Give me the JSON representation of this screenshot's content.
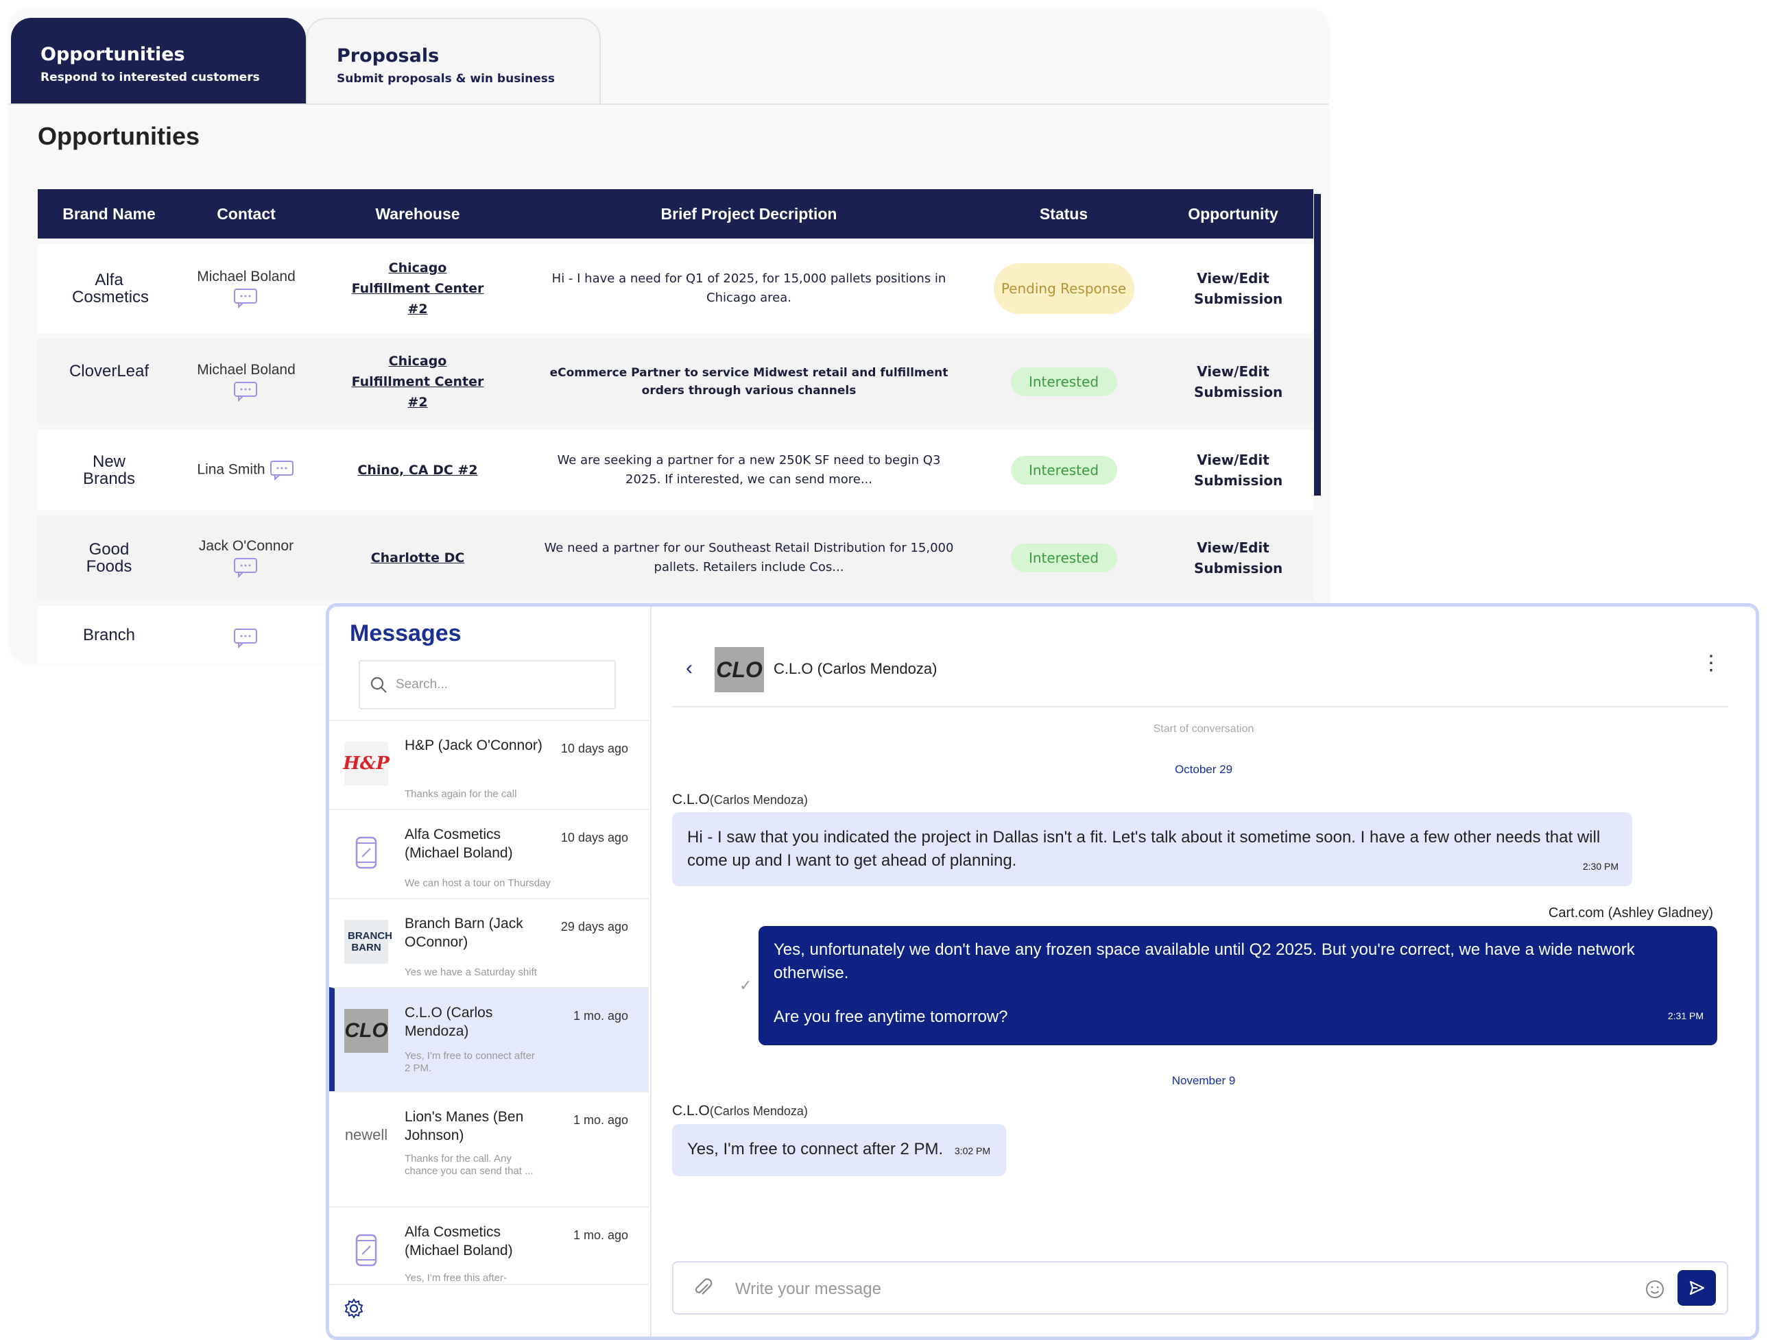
{
  "tabs": [
    {
      "title": "Opportunities",
      "subtitle": "Respond to interested customers"
    },
    {
      "title": "Proposals",
      "subtitle": "Submit proposals & win business"
    }
  ],
  "page_title": "Opportunities",
  "table": {
    "headers": [
      "Brand Name",
      "Contact",
      "Warehouse",
      "Brief Project Decription",
      "Status",
      "Opportunity"
    ],
    "rows": [
      {
        "brand": "Alfa Cosmetics",
        "contact": "Michael Boland",
        "warehouse": "Chicago Fulfillment Center #2",
        "description": "Hi - I have a need for Q1 of 2025, for 15,000 pallets positions in Chicago area.",
        "status": "Pending Response",
        "action": "View/Edit Submission"
      },
      {
        "brand": "CloverLeaf",
        "contact": "Michael Boland",
        "warehouse": "Chicago Fulfillment Center #2",
        "description": "eCommerce Partner to service Midwest retail and fulfillment orders through various channels",
        "status": "Interested",
        "action": "View/Edit Submission"
      },
      {
        "brand": "New Brands",
        "contact": "Lina Smith",
        "warehouse": "Chino, CA DC #2",
        "description": "We are seeking a partner for a new 250K SF need to begin Q3 2025. If interested, we can send more...",
        "status": "Interested",
        "action": "View/Edit Submission"
      },
      {
        "brand": "Good Foods",
        "contact": "Jack O'Connor",
        "warehouse": "Charlotte DC",
        "description": "We need a partner for our Southeast Retail Distribution for 15,000 pallets. Retailers include Cos...",
        "status": "Interested",
        "action": "View/Edit Submission"
      },
      {
        "brand": "Branch",
        "contact": "",
        "warehouse": "",
        "description": "",
        "status": "",
        "action": ""
      }
    ]
  },
  "messages": {
    "heading": "Messages",
    "search_placeholder": "Search...",
    "conversations": [
      {
        "logo": "hp-logo",
        "logo_text": "H&P",
        "name": "H&P (Jack O'Connor)",
        "time": "10 days ago",
        "preview": "Thanks again for the call"
      },
      {
        "logo": "can-icon",
        "name": "Alfa Cosmetics (Michael Boland)",
        "time": "10 days ago",
        "preview": "We can host a tour on Thursday"
      },
      {
        "logo": "branch-barn-logo",
        "logo_text": "BRANCH BARN",
        "name": "Branch Barn (Jack OConnor)",
        "time": "29 days ago",
        "preview": "Yes we have a Saturday shift"
      },
      {
        "logo": "clo-logo",
        "logo_text": "CLO",
        "name": "C.L.O (Carlos Mendoza)",
        "time": "1 mo. ago",
        "preview": "Yes, I'm free to connect after 2 PM.",
        "active": true
      },
      {
        "logo": "newell-logo",
        "logo_text": "newell",
        "name": "Lion's Manes (Ben Johnson)",
        "time": "1 mo. ago",
        "preview": "Thanks for the call. Any chance you can send that ..."
      },
      {
        "logo": "can-icon",
        "name": "Alfa Cosmetics (Michael Boland)",
        "time": "1 mo. ago",
        "preview": "Yes, I'm free this after-"
      }
    ],
    "chat": {
      "header_logo_text": "CLO",
      "header_name": "C.L.O (Carlos Mendoza)",
      "start_text": "Start of conversation",
      "date1": "October 29",
      "sender1": "C.L.O",
      "sender1_sub": "(Carlos Mendoza)",
      "msg1": "Hi - I saw that you indicated the project in Dallas isn't a fit. Let's talk about it sometime soon. I have a few other needs that will come up and I want to get ahead of planning.",
      "msg1_time": "2:30 PM",
      "sender2": "Cart.com (Ashley Gladney)",
      "msg2_line1": "Yes, unfortunately we don't have any frozen space available until Q2 2025. But you're correct, we have a wide network otherwise.",
      "msg2_line2": "Are you free anytime tomorrow?",
      "msg2_time": "2:31 PM",
      "date2": "November 9",
      "sender3": "C.L.O",
      "sender3_sub": "(Carlos Mendoza)",
      "msg3": "Yes, I'm free to connect after 2 PM.",
      "msg3_time": "3:02 PM",
      "composer_placeholder": "Write your message"
    }
  },
  "colors": {
    "navy": "#1a2150",
    "accent": "#1a2f8f",
    "bubble_out": "#0d2283",
    "bubble_in": "#e2e7fb",
    "pending": "#fbefc4",
    "interested": "#d6f5d2"
  }
}
